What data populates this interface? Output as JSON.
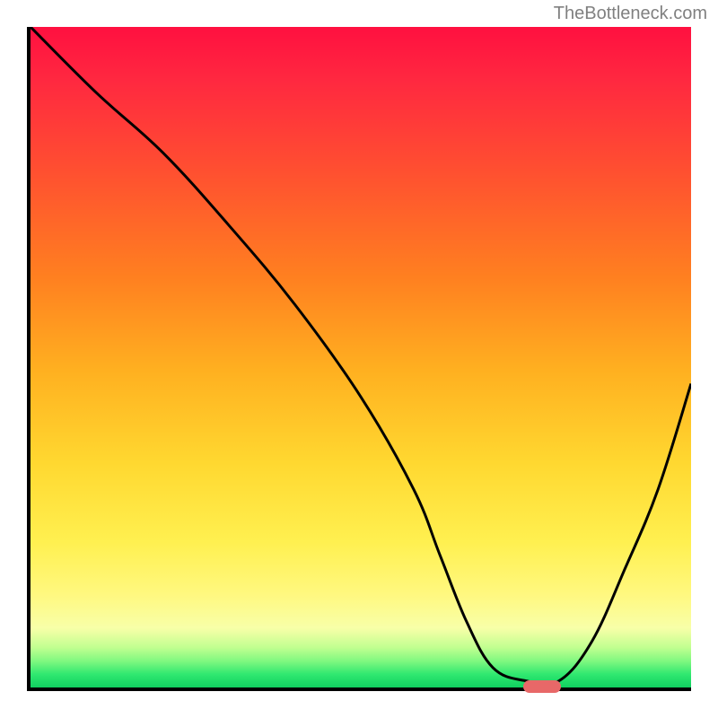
{
  "watermark": "TheBottleneck.com",
  "chart_data": {
    "type": "line",
    "title": "",
    "xlabel": "",
    "ylabel": "",
    "x_range": [
      0,
      100
    ],
    "y_range": [
      0,
      100
    ],
    "series": [
      {
        "name": "bottleneck-curve",
        "x": [
          0,
          10,
          20,
          30,
          40,
          50,
          58,
          62,
          66,
          70,
          75,
          80,
          85,
          90,
          95,
          100
        ],
        "y": [
          100,
          90,
          81,
          70,
          58,
          44,
          30,
          20,
          10,
          3,
          1,
          1,
          7,
          18,
          30,
          46
        ]
      }
    ],
    "optimum_marker": {
      "x": 77,
      "y": 0.7
    },
    "gradient_stops": [
      {
        "pct": 0,
        "color": "#ff1040"
      },
      {
        "pct": 8,
        "color": "#ff2840"
      },
      {
        "pct": 22,
        "color": "#ff5030"
      },
      {
        "pct": 38,
        "color": "#ff8020"
      },
      {
        "pct": 52,
        "color": "#ffb020"
      },
      {
        "pct": 66,
        "color": "#ffd830"
      },
      {
        "pct": 78,
        "color": "#fff050"
      },
      {
        "pct": 86,
        "color": "#fff880"
      },
      {
        "pct": 91,
        "color": "#f8ffa8"
      },
      {
        "pct": 94,
        "color": "#c0ff90"
      },
      {
        "pct": 96,
        "color": "#80f880"
      },
      {
        "pct": 98,
        "color": "#30e870"
      },
      {
        "pct": 100,
        "color": "#10d060"
      }
    ]
  }
}
